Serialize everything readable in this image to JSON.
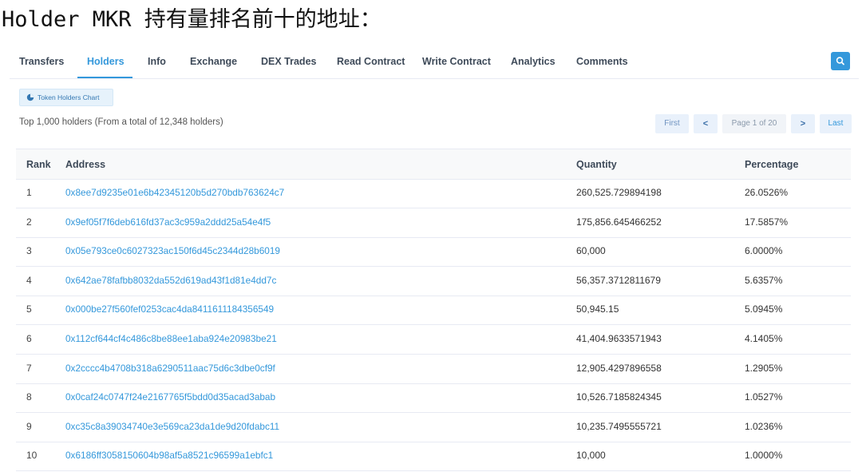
{
  "heading": "Holder MKR 持有量排名前十的地址：",
  "tabs": [
    {
      "label": "Transfers"
    },
    {
      "label": "Holders"
    },
    {
      "label": "Info"
    },
    {
      "label": "Exchange"
    },
    {
      "label": "DEX Trades"
    },
    {
      "label": "Read Contract"
    },
    {
      "label": "Write Contract"
    },
    {
      "label": "Analytics"
    },
    {
      "label": "Comments"
    }
  ],
  "active_tab": "Holders",
  "chart_button": {
    "label": "Token Holders Chart",
    "icon": "pie-chart-icon"
  },
  "summary": "Top 1,000 holders (From a total of 12,348 holders)",
  "pagination": {
    "first": "First",
    "prev": "<",
    "page": "Page 1 of 20",
    "next": ">",
    "last": "Last"
  },
  "table": {
    "columns": [
      "Rank",
      "Address",
      "Quantity",
      "Percentage"
    ],
    "rows": [
      {
        "rank": "1",
        "address": "0x8ee7d9235e01e6b42345120b5d270bdb763624c7",
        "quantity": "260,525.729894198",
        "percentage": "26.0526%"
      },
      {
        "rank": "2",
        "address": "0x9ef05f7f6deb616fd37ac3c959a2ddd25a54e4f5",
        "quantity": "175,856.645466252",
        "percentage": "17.5857%"
      },
      {
        "rank": "3",
        "address": "0x05e793ce0c6027323ac150f6d45c2344d28b6019",
        "quantity": "60,000",
        "percentage": "6.0000%"
      },
      {
        "rank": "4",
        "address": "0x642ae78fafbb8032da552d619ad43f1d81e4dd7c",
        "quantity": "56,357.3712811679",
        "percentage": "5.6357%"
      },
      {
        "rank": "5",
        "address": "0x000be27f560fef0253cac4da8411611184356549",
        "quantity": "50,945.15",
        "percentage": "5.0945%"
      },
      {
        "rank": "6",
        "address": "0x112cf644cf4c486c8be88ee1aba924e20983be21",
        "quantity": "41,404.9633571943",
        "percentage": "4.1405%"
      },
      {
        "rank": "7",
        "address": "0x2cccc4b4708b318a6290511aac75d6c3dbe0cf9f",
        "quantity": "12,905.4297896558",
        "percentage": "1.2905%"
      },
      {
        "rank": "8",
        "address": "0x0caf24c0747f24e2167765f5bdd0d35acad3abab",
        "quantity": "10,526.7185824345",
        "percentage": "1.0527%"
      },
      {
        "rank": "9",
        "address": "0xc35c8a39034740e3e569ca23da1de9d20fdabc11",
        "quantity": "10,235.7495555721",
        "percentage": "1.0236%"
      },
      {
        "rank": "10",
        "address": "0x6186ff3058150604b98af5a8521c96599a1ebfc1",
        "quantity": "10,000",
        "percentage": "1.0000%"
      }
    ]
  },
  "colors": {
    "accent": "#3498db",
    "header_bg": "#f8f9fa",
    "border": "#e7eaf3"
  }
}
